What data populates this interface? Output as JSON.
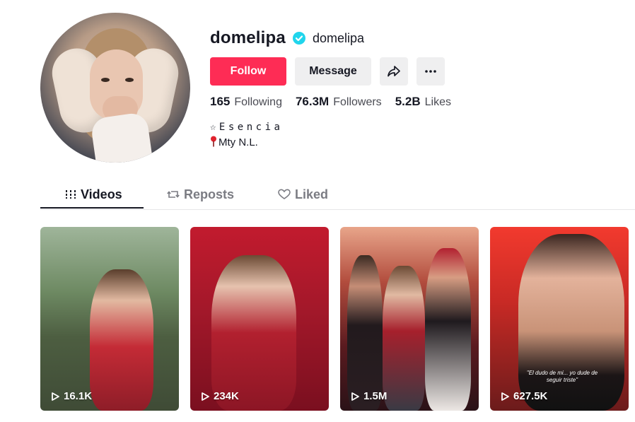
{
  "profile": {
    "username": "domelipa",
    "nickname": "domelipa",
    "verified": true,
    "bio_line1": "☆Esencia",
    "bio_line2": "Mty N.L."
  },
  "actions": {
    "follow_label": "Follow",
    "message_label": "Message",
    "share_icon": "share-icon",
    "more_icon": "more-icon"
  },
  "stats": {
    "following_value": "165",
    "following_label": "Following",
    "followers_value": "76.3M",
    "followers_label": "Followers",
    "likes_value": "5.2B",
    "likes_label": "Likes"
  },
  "tabs": [
    {
      "label": "Videos",
      "icon": "grid-icon",
      "active": true
    },
    {
      "label": "Reposts",
      "icon": "repost-icon",
      "active": false
    },
    {
      "label": "Liked",
      "icon": "heart-icon",
      "active": false
    }
  ],
  "videos": [
    {
      "views": "16.1K",
      "caption": ""
    },
    {
      "views": "234K",
      "caption": ""
    },
    {
      "views": "1.5M",
      "caption": ""
    },
    {
      "views": "627.5K",
      "caption": "\"El dudo de mi... yo dude de seguir triste\""
    }
  ],
  "colors": {
    "accent": "#fe2c55",
    "verified": "#20d5ec",
    "text": "#161823",
    "muted": "#7b7c83"
  }
}
